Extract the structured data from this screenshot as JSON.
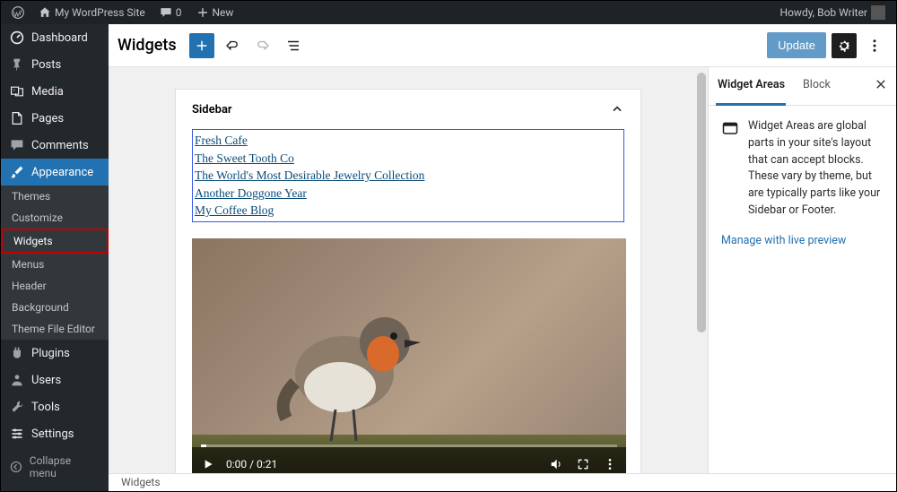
{
  "adminbar": {
    "site_name": "My WordPress Site",
    "comment_count": "0",
    "new_label": "New",
    "howdy": "Howdy, Bob Writer"
  },
  "sidebar": {
    "items": [
      {
        "name": "dashboard",
        "label": "Dashboard"
      },
      {
        "name": "posts",
        "label": "Posts"
      },
      {
        "name": "media",
        "label": "Media"
      },
      {
        "name": "pages",
        "label": "Pages"
      },
      {
        "name": "comments",
        "label": "Comments"
      },
      {
        "name": "appearance",
        "label": "Appearance"
      },
      {
        "name": "plugins",
        "label": "Plugins"
      },
      {
        "name": "users",
        "label": "Users"
      },
      {
        "name": "tools",
        "label": "Tools"
      },
      {
        "name": "settings",
        "label": "Settings"
      }
    ],
    "appearance_sub": [
      {
        "label": "Themes"
      },
      {
        "label": "Customize"
      },
      {
        "label": "Widgets"
      },
      {
        "label": "Menus"
      },
      {
        "label": "Header"
      },
      {
        "label": "Background"
      },
      {
        "label": "Theme File Editor"
      }
    ],
    "collapse_label": "Collapse menu"
  },
  "editor": {
    "title": "Widgets",
    "update_label": "Update",
    "widget_area_title": "Sidebar",
    "rss_links": [
      "Fresh Cafe",
      "The Sweet Tooth Co",
      "The World's Most Desirable Jewelry Collection",
      "Another Doggone Year",
      "My Coffee Blog"
    ],
    "video": {
      "time_text": "0:00 / 0:21"
    }
  },
  "settings_panel": {
    "tab_widget_areas": "Widget Areas",
    "tab_block": "Block",
    "description": "Widget Areas are global parts in your site's layout that can accept blocks. These vary by theme, but are typically parts like your Sidebar or Footer.",
    "live_preview_link": "Manage with live preview"
  },
  "breadcrumb": "Widgets"
}
